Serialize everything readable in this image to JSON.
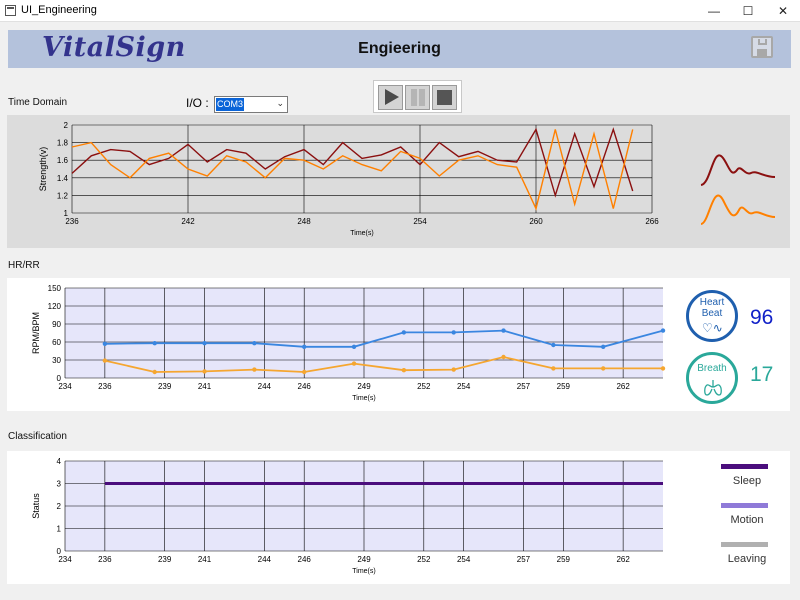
{
  "window": {
    "title": "UI_Engineering",
    "minimize": "—",
    "maximize": "☐",
    "close": "✕"
  },
  "header": {
    "logo": "VitalSign",
    "title": "Engieering",
    "save_icon": "save-icon"
  },
  "controls": {
    "io_label": "I/O :",
    "io_value": "COM3",
    "buttons": [
      "play-icon",
      "pause-icon",
      "stop-icon"
    ]
  },
  "time_domain": {
    "label": "Time Domain",
    "chart_data": {
      "type": "line",
      "xlabel": "Time(s)",
      "ylabel": "Strength(v)",
      "xlim": [
        236,
        266
      ],
      "ylim": [
        1,
        2
      ],
      "x_ticks": [
        236,
        242,
        248,
        254,
        260,
        266
      ],
      "y_ticks": [
        "1",
        "1.2",
        "1.4",
        "1.6",
        "1.8",
        "2"
      ],
      "series": [
        {
          "color": "#8b1010",
          "x": [
            236,
            237,
            238,
            239,
            240,
            241,
            242,
            243,
            244,
            245,
            246,
            247,
            248,
            249,
            250,
            251,
            252,
            253,
            254,
            255,
            256,
            257,
            258,
            259,
            260,
            261,
            262,
            263,
            264,
            265
          ],
          "y": [
            1.45,
            1.65,
            1.72,
            1.7,
            1.55,
            1.62,
            1.78,
            1.58,
            1.72,
            1.68,
            1.5,
            1.64,
            1.72,
            1.55,
            1.8,
            1.62,
            1.66,
            1.75,
            1.55,
            1.8,
            1.64,
            1.7,
            1.6,
            1.58,
            1.95,
            1.2,
            1.9,
            1.3,
            1.95,
            1.25
          ]
        },
        {
          "color": "#ff8000",
          "x": [
            236,
            237,
            238,
            239,
            240,
            241,
            242,
            243,
            244,
            245,
            246,
            247,
            248,
            249,
            250,
            251,
            252,
            253,
            254,
            255,
            256,
            257,
            258,
            259,
            260,
            261,
            262,
            263,
            264,
            265
          ],
          "y": [
            1.75,
            1.8,
            1.55,
            1.4,
            1.62,
            1.68,
            1.5,
            1.42,
            1.65,
            1.58,
            1.4,
            1.62,
            1.6,
            1.5,
            1.65,
            1.55,
            1.48,
            1.7,
            1.62,
            1.42,
            1.6,
            1.65,
            1.55,
            1.52,
            1.05,
            1.95,
            1.1,
            1.9,
            1.05,
            1.95
          ]
        }
      ]
    }
  },
  "hr_rr": {
    "label": "HR/RR",
    "chart_data": {
      "type": "line",
      "xlabel": "Time(s)",
      "ylabel": "RPM/BPM",
      "xlim": [
        234,
        264
      ],
      "ylim": [
        0,
        150
      ],
      "x_ticks": [
        234,
        236,
        239,
        241,
        244,
        246,
        249,
        252,
        254,
        257,
        259,
        262
      ],
      "y_ticks": [
        "0",
        "30",
        "60",
        "90",
        "120",
        "150"
      ],
      "series": [
        {
          "color": "#3a86e0",
          "x": [
            236,
            238.5,
            241,
            243.5,
            246,
            248.5,
            251,
            253.5,
            256,
            258.5,
            261,
            264
          ],
          "y": [
            57,
            58,
            58,
            58,
            52,
            52,
            76,
            76,
            79,
            55,
            52,
            79
          ]
        },
        {
          "color": "#f5a630",
          "x": [
            236,
            238.5,
            241,
            243.5,
            246,
            248.5,
            251,
            253.5,
            256,
            258.5,
            261,
            264
          ],
          "y": [
            29,
            10,
            11,
            14,
            10,
            24,
            13,
            14,
            35,
            16,
            16,
            16
          ]
        }
      ]
    }
  },
  "indicators": {
    "heart": {
      "label": "Heart Beat",
      "value": "96",
      "icon": "heart-pulse-icon"
    },
    "breath": {
      "label": "Breath",
      "value": "17",
      "icon": "lungs-icon"
    }
  },
  "classification": {
    "label": "Classification",
    "chart_data": {
      "type": "line",
      "xlabel": "Time(s)",
      "ylabel": "Status",
      "xlim": [
        234,
        264
      ],
      "ylim": [
        0,
        4
      ],
      "x_ticks": [
        234,
        236,
        239,
        241,
        244,
        246,
        249,
        252,
        254,
        257,
        259,
        262
      ],
      "y_ticks": [
        "0",
        "1",
        "2",
        "3",
        "4"
      ],
      "series": [
        {
          "color": "#4b0e7d",
          "x": [
            236,
            264
          ],
          "y": [
            3,
            3
          ]
        }
      ]
    },
    "legend": [
      {
        "label": "Sleep",
        "color": "#4b0e7d"
      },
      {
        "label": "Motion",
        "color": "#8f7ad8"
      },
      {
        "label": "Leaving",
        "color": "#b0b0b0"
      }
    ]
  }
}
